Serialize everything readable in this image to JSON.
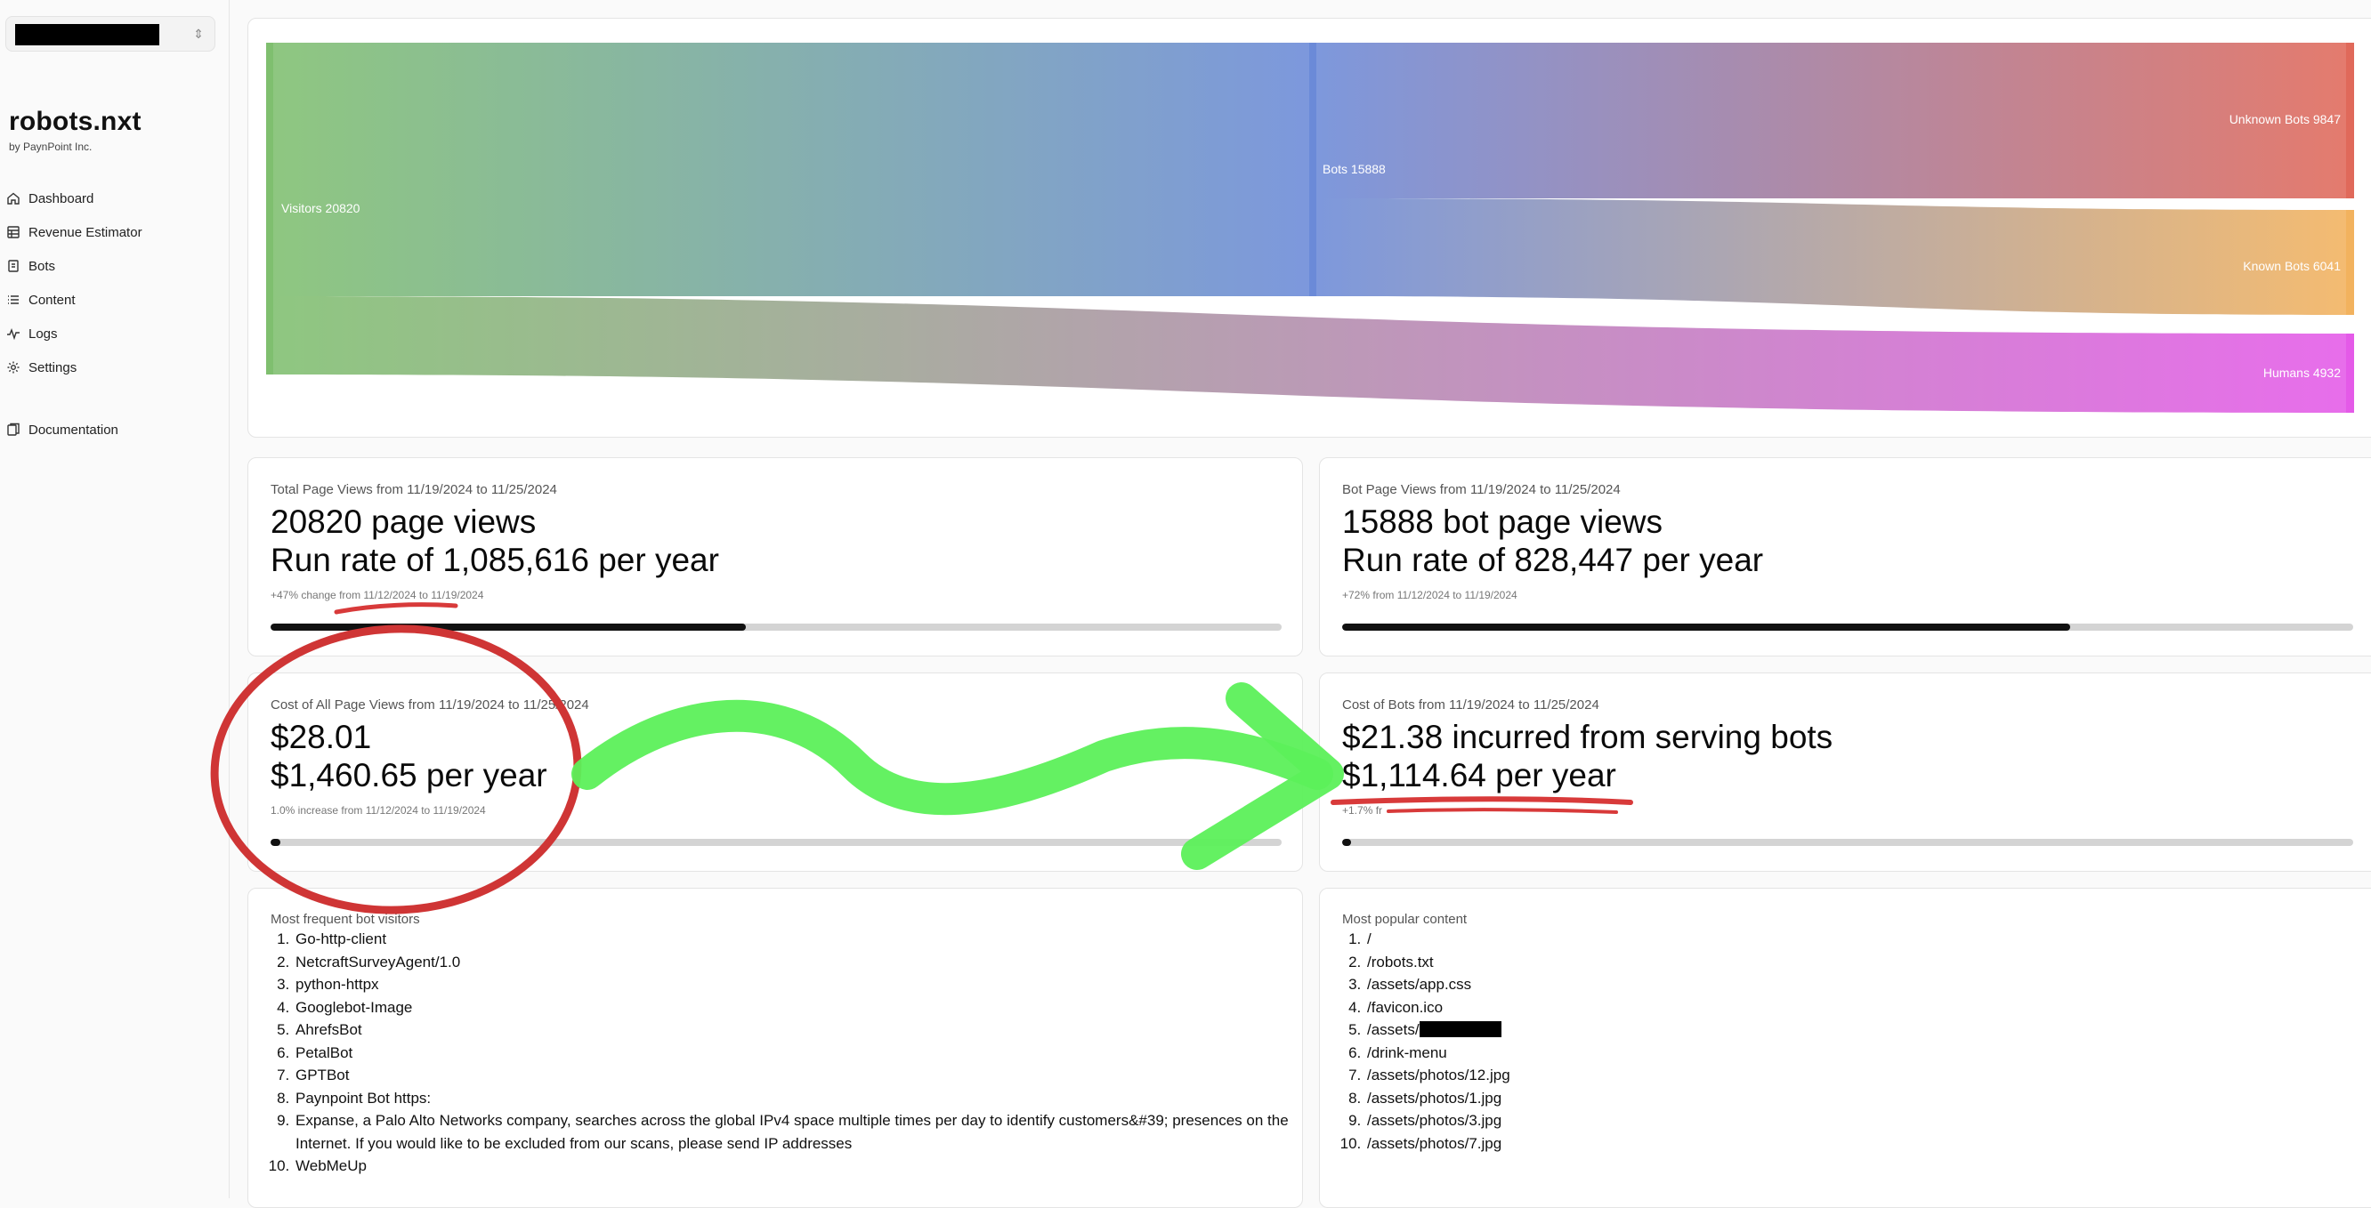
{
  "sidebar": {
    "brand": "robots.nxt",
    "brand_sub": "by PaynPoint Inc.",
    "switcher_icon": "chevron-up-down-icon",
    "nav": [
      {
        "label": "Dashboard",
        "icon": "home-icon"
      },
      {
        "label": "Revenue Estimator",
        "icon": "table-icon"
      },
      {
        "label": "Bots",
        "icon": "file-icon"
      },
      {
        "label": "Content",
        "icon": "list-icon"
      },
      {
        "label": "Logs",
        "icon": "activity-icon"
      },
      {
        "label": "Settings",
        "icon": "gear-icon"
      }
    ],
    "documentation": {
      "label": "Documentation",
      "icon": "documents-icon"
    }
  },
  "sankey": {
    "visitors": "Visitors 20820",
    "bots": "Bots 15888",
    "unknown_bots": "Unknown Bots 9847",
    "known_bots": "Known Bots 6041",
    "humans": "Humans 4932",
    "colors": {
      "visitors": "#7fbf6f",
      "bots": "#6b8ad8",
      "unknown": "#e0695a",
      "known": "#f2b25e",
      "humans": "#e45ae8"
    }
  },
  "cards": {
    "total": {
      "caption": "Total Page Views from 11/19/2024 to 11/25/2024",
      "line1": "20820 page views",
      "line2": "Run rate of 1,085,616 per year",
      "note": "+47% change from 11/12/2024 to 11/19/2024",
      "progress": 0.47
    },
    "bot": {
      "caption": "Bot Page Views from 11/19/2024 to 11/25/2024",
      "line1": "15888 bot page views",
      "line2": "Run rate of 828,447 per year",
      "note": "+72% from 11/12/2024 to 11/19/2024",
      "progress": 0.72
    },
    "cost_all": {
      "caption": "Cost of All Page Views from 11/19/2024 to 11/25/2024",
      "line1": "$28.01",
      "line2": "$1,460.65 per year",
      "note": "1.0% increase from 11/12/2024 to 11/19/2024",
      "progress": 0.01
    },
    "cost_bots": {
      "caption": "Cost of Bots from 11/19/2024 to 11/25/2024",
      "line1": "$21.38 incurred from serving bots",
      "line2": "$1,114.64 per year",
      "note": "+1.7% fr",
      "progress": 0.009
    }
  },
  "lists": {
    "bots": {
      "caption": "Most frequent bot visitors",
      "items": [
        "Go-http-client",
        "NetcraftSurveyAgent/1.0",
        "python-httpx",
        "Googlebot-Image",
        "AhrefsBot",
        "PetalBot",
        "GPTBot",
        "Paynpoint Bot https:",
        "Expanse, a Palo Alto Networks company, searches across the global IPv4 space multiple times per day to identify customers&#39; presences on the Internet. If you would like to be excluded from our scans, please send IP addresses",
        "WebMeUp"
      ]
    },
    "content": {
      "caption": "Most popular content",
      "items": [
        "/",
        "/robots.txt",
        "/assets/app.css",
        "/favicon.ico",
        "/assets/",
        "/drink-menu",
        "/assets/photos/12.jpg",
        "/assets/photos/1.jpg",
        "/assets/photos/3.jpg",
        "/assets/photos/7.jpg"
      ]
    }
  },
  "annotations": {
    "circle_color": "#cf3535",
    "arrow_color": "#5cf05a",
    "underline_color": "#d83a3a"
  }
}
